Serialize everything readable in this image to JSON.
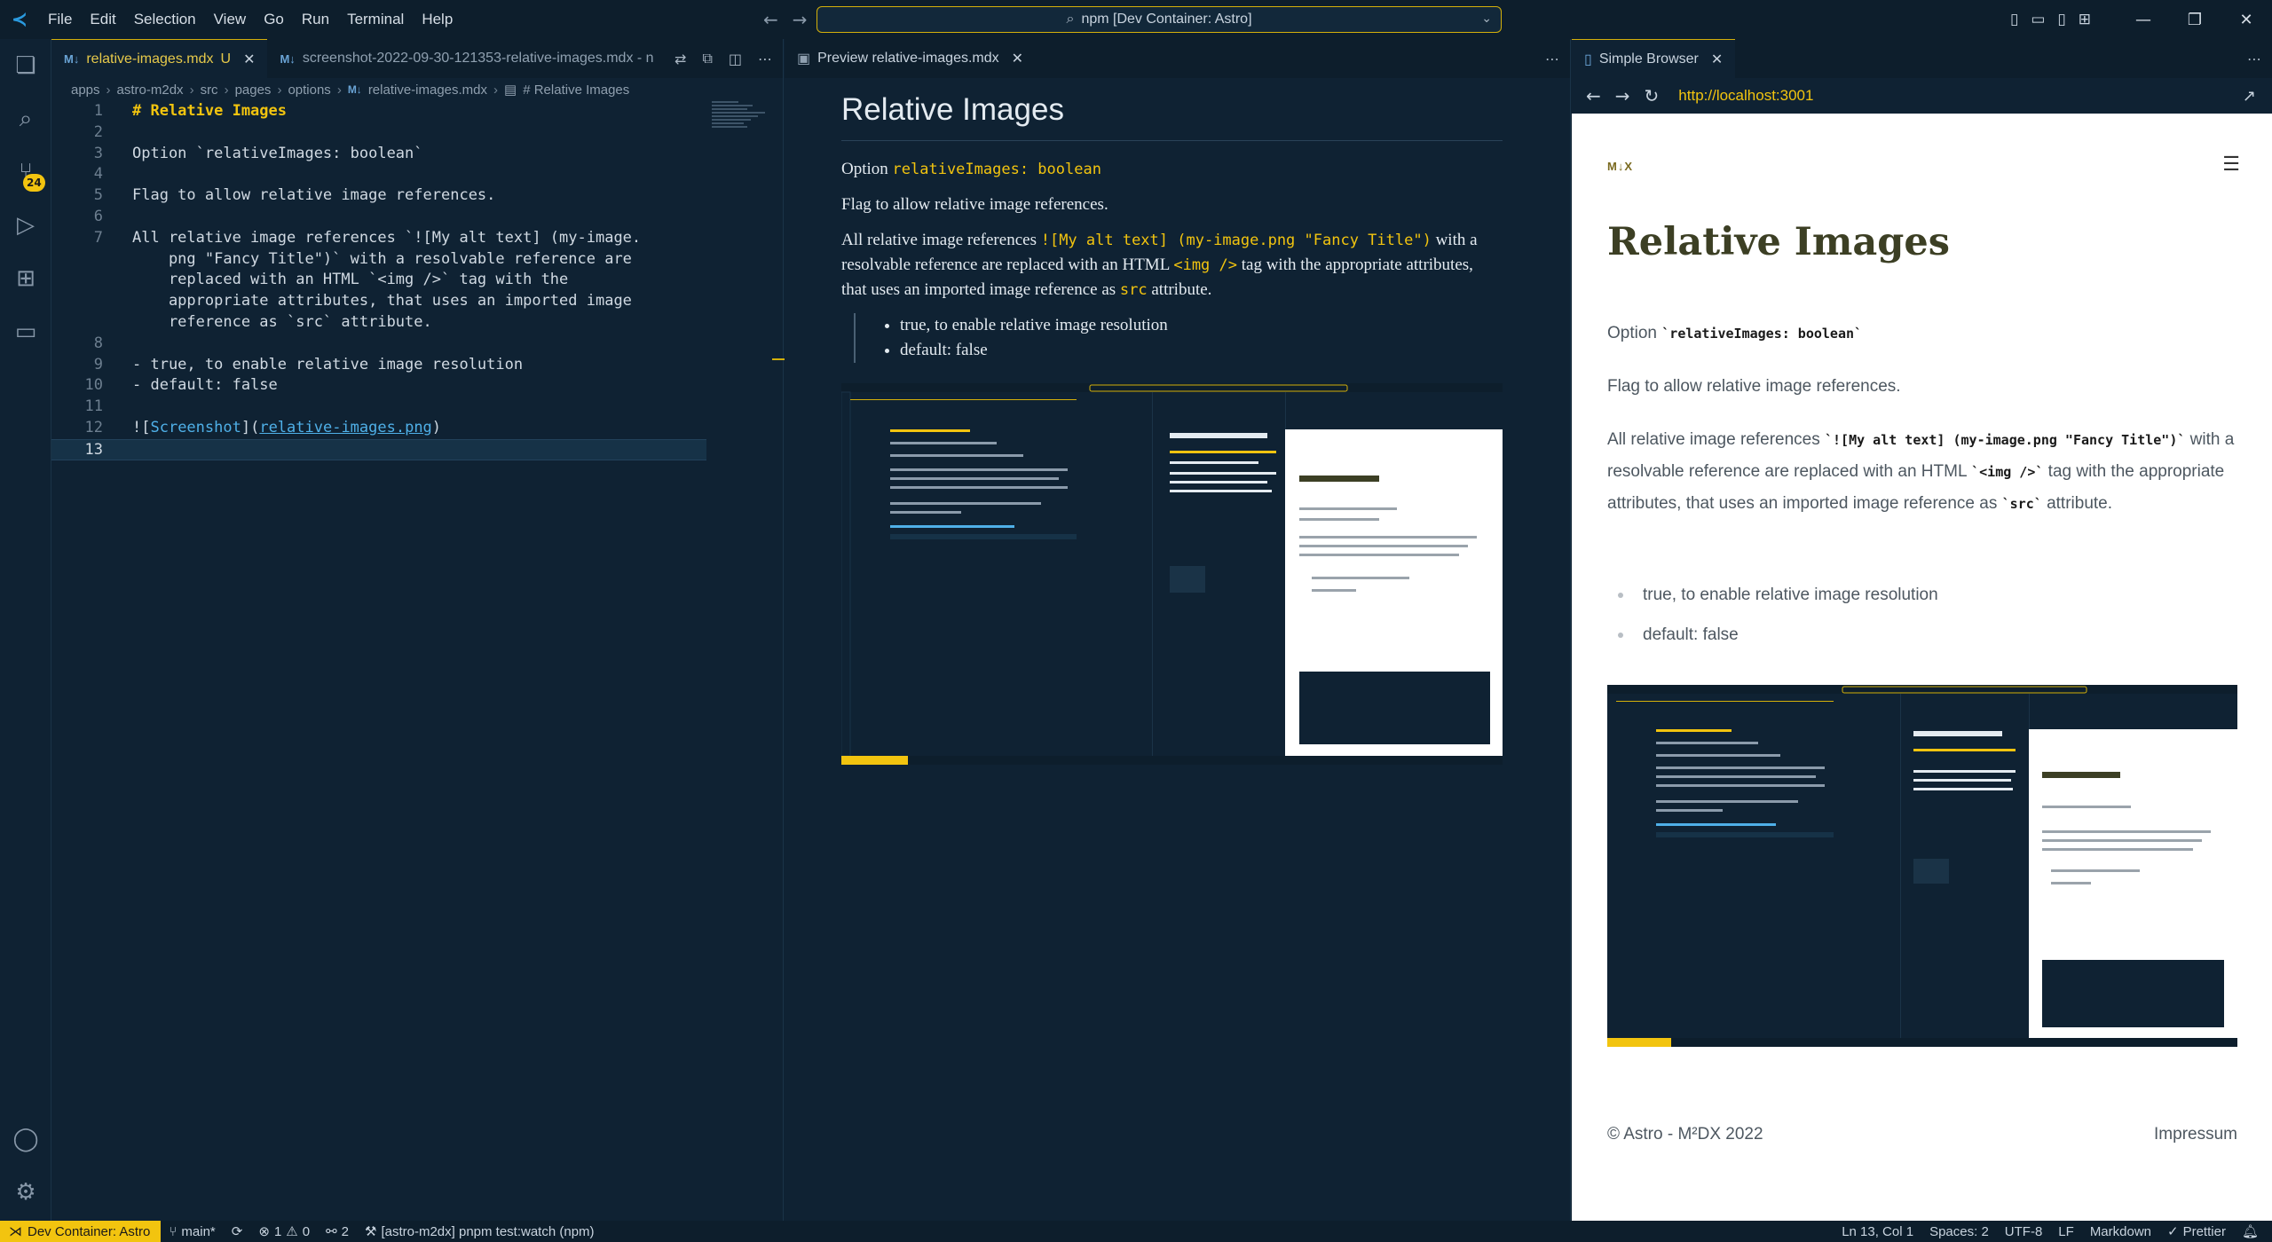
{
  "titlebar": {
    "menu": [
      "File",
      "Edit",
      "Selection",
      "View",
      "Go",
      "Run",
      "Terminal",
      "Help"
    ],
    "command_center": "npm [Dev Container: Astro]"
  },
  "activity": {
    "source_control_badge": "24"
  },
  "editor": {
    "tabs": [
      {
        "label": "relative-images.mdx",
        "status": "U"
      },
      {
        "label": "screenshot-2022-09-30-121353-relative-images.mdx - n"
      }
    ],
    "breadcrumb": [
      "apps",
      "astro-m2dx",
      "src",
      "pages",
      "options",
      "relative-images.mdx",
      "# Relative Images"
    ],
    "lines": {
      "l1": "# Relative Images",
      "l3": "Option `relativeImages: boolean`",
      "l5": "Flag to allow relative image references.",
      "l7a": "All relative image references `![My alt text] (my-image.",
      "l7b": "    png \"Fancy Title\")` with a resolvable reference are",
      "l7c": "    replaced with an HTML `<img />` tag with the",
      "l7d": "    appropriate attributes, that uses an imported image",
      "l7e": "    reference as `src` attribute.",
      "l9": "- true, to enable relative image resolution",
      "l10": "- default: false",
      "l12_alt": "Screenshot",
      "l12_url": "relative-images.png"
    }
  },
  "preview": {
    "tab_label": "Preview relative-images.mdx",
    "title": "Relative Images",
    "option_label": "Option",
    "option_code": "relativeImages: boolean",
    "flag_text": "Flag to allow relative image references.",
    "p_intro": "All relative image references",
    "p_code1": "![My alt text] (my-image.png \"Fancy Title\")",
    "p_mid": "with a resolvable reference are replaced with an HTML",
    "p_code2": "<img />",
    "p_mid2": "tag with the appropriate attributes, that uses an imported image reference as",
    "p_code3": "src",
    "p_end": "attribute.",
    "list": [
      "true, to enable relative image resolution",
      "default: false"
    ]
  },
  "browser": {
    "tab_label": "Simple Browser",
    "url": "http://localhost:3001",
    "logo": "M↓X",
    "title": "Relative Images",
    "option_label": "Option",
    "option_code": "`relativeImages: boolean`",
    "flag_text": "Flag to allow relative image references.",
    "p_intro": "All relative image references",
    "p_code1": "`![My alt text] (my-image.png \"Fancy Title\")`",
    "p_mid": "with a resolvable reference are replaced with an HTML",
    "p_code2": "`<img />`",
    "p_mid2": "tag with the appropriate attributes, that uses an imported image reference as",
    "p_code3": "`src`",
    "p_end": "attribute.",
    "list": [
      "true, to enable relative image resolution",
      "default: false"
    ],
    "footer_left": "© Astro - M²DX 2022",
    "footer_right": "Impressum"
  },
  "statusbar": {
    "remote": "Dev Container: Astro",
    "branch": "main*",
    "errors": "1",
    "warnings": "0",
    "ports": "2",
    "task": "[astro-m2dx] pnpm test:watch (npm)",
    "position": "Ln 13, Col 1",
    "spaces": "Spaces: 2",
    "encoding": "UTF-8",
    "eol": "LF",
    "language": "Markdown",
    "formatter": "Prettier"
  },
  "colors": {
    "accent": "#f2c40f",
    "background": "#0f2233",
    "link": "#4fb0e8"
  }
}
